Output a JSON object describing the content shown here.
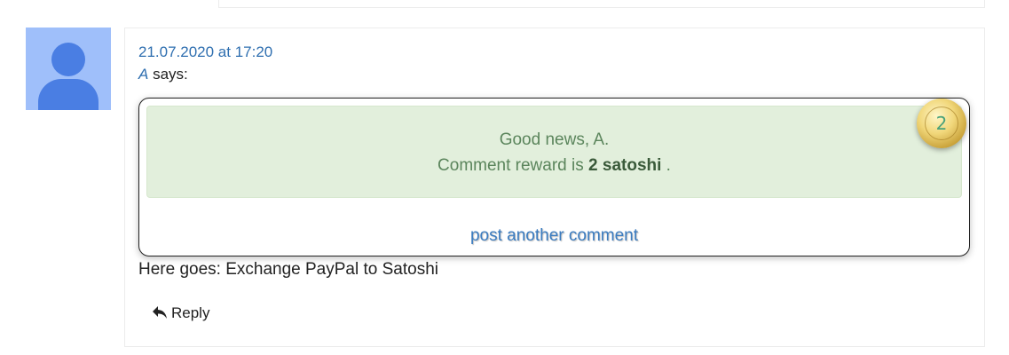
{
  "comment": {
    "date": "21.07.2020 at 17:20",
    "author": "A",
    "says": " says:",
    "text": "Here goes: Exchange PayPal to Satoshi",
    "reply_label": "Reply"
  },
  "reward_popup": {
    "greeting": "Good news, A.",
    "reward_prefix": "Comment reward is ",
    "reward_amount": "2 satoshi",
    "reward_suffix": " .",
    "coin_value": "2",
    "post_another_label": "post another comment"
  },
  "icons": {
    "avatar": "avatar-icon",
    "coin": "bitcoin-coin-icon",
    "reply": "reply-arrow-icon"
  },
  "colors": {
    "link": "#2f6fb0",
    "alert_bg": "#e2efdc",
    "alert_text": "#5b855c",
    "avatar_bg": "#9fbffa"
  }
}
